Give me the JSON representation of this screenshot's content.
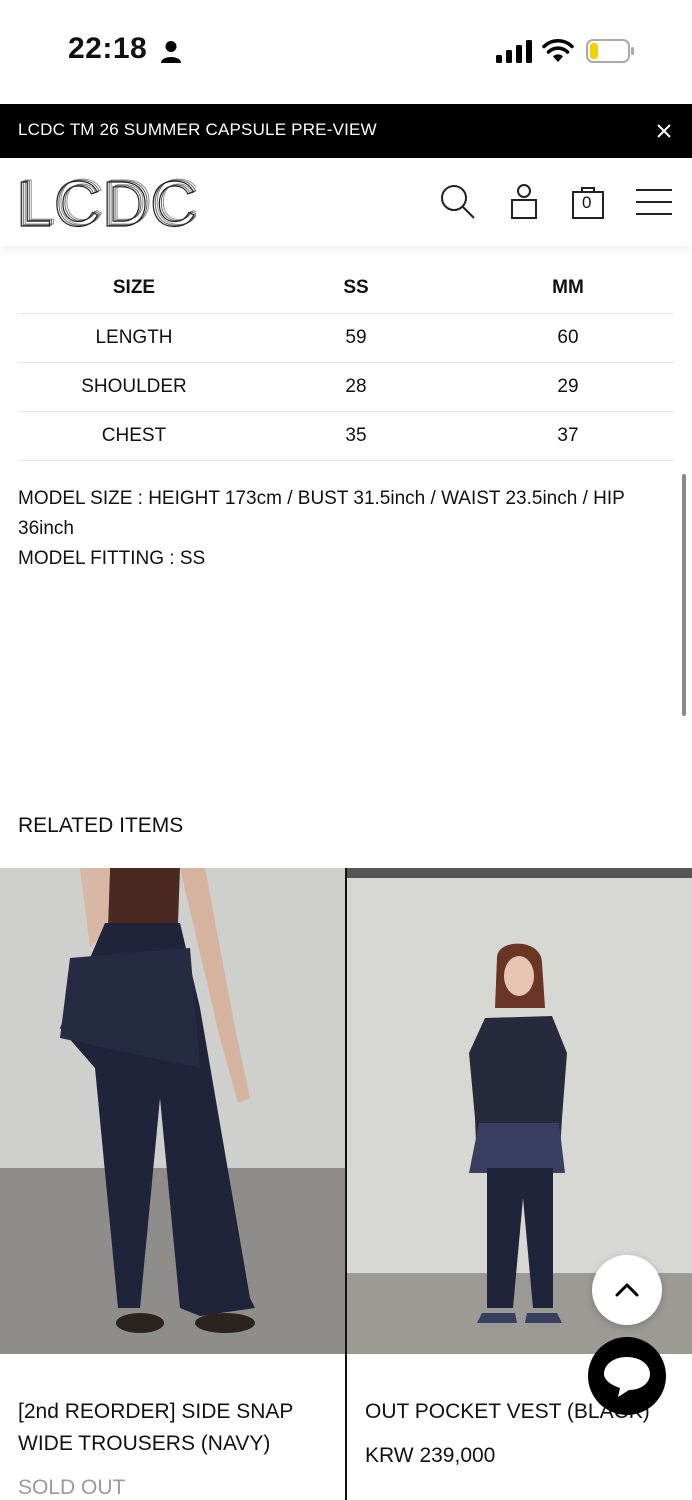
{
  "status_bar": {
    "time": "22:18"
  },
  "announcement": {
    "text": "LCDC TM 26 SUMMER CAPSULE PRE-VIEW"
  },
  "header": {
    "logo_text": "LCDC",
    "cart_count": "0"
  },
  "size_table": {
    "headers": [
      "SIZE",
      "SS",
      "MM"
    ],
    "rows": [
      [
        "LENGTH",
        "59",
        "60"
      ],
      [
        "SHOULDER",
        "28",
        "29"
      ],
      [
        "CHEST",
        "35",
        "37"
      ]
    ]
  },
  "model_info": {
    "size_line": "MODEL SIZE : HEIGHT 173cm / BUST 31.5inch / WAIST 23.5inch / HIP 36inch",
    "fitting_line": "MODEL FITTING : SS"
  },
  "related": {
    "title": "RELATED ITEMS",
    "products": [
      {
        "name": "[2nd REORDER] SIDE SNAP WIDE TROUSERS (NAVY)",
        "status": "SOLD OUT"
      },
      {
        "name": "OUT POCKET VEST (BLACK)",
        "price": "KRW 239,000"
      }
    ]
  },
  "colors": {
    "navy": "#20243a",
    "wall": "#c9c9c7",
    "floor": "#8d8c88",
    "accent": "#000000"
  }
}
